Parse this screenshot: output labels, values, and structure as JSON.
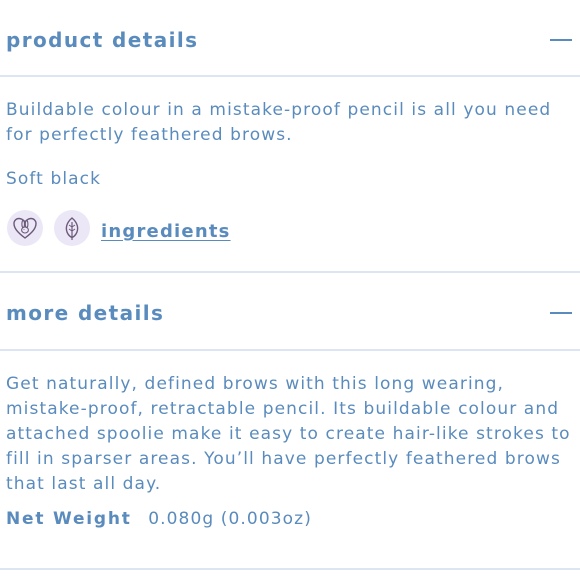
{
  "product_details": {
    "title": "product details",
    "description": "Buildable colour in a mistake-proof pencil is all you need for perfectly feathered brows.",
    "shade": "Soft black",
    "badges": [
      {
        "icon": "cruelty-free-bunny-heart-icon"
      },
      {
        "icon": "vegan-leaf-icon"
      }
    ],
    "ingredients_link": "ingredients"
  },
  "more_details": {
    "title": "more details",
    "description": "Get naturally, defined brows with this long wearing, mistake-proof, retractable pencil. Its buildable colour and attached spoolie make it easy to create hair-like strokes to fill in sparser areas. You’ll have perfectly feathered brows that last all day.",
    "net_weight_label": "Net Weight",
    "net_weight_value": "0.080g (0.003oz)"
  },
  "colors": {
    "text": "#5a8bbd",
    "divider": "#dbe6f2",
    "badge_bg": "#ece7f6",
    "icon_stroke": "#6b5a7a"
  }
}
